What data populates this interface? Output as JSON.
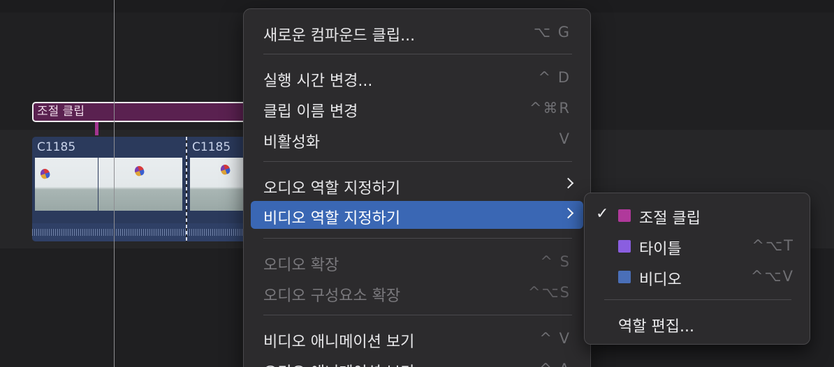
{
  "timeline": {
    "compound_clip_label": "조절 클립",
    "clips": [
      {
        "name": "C1185"
      },
      {
        "name": "C1185"
      }
    ]
  },
  "context_menu": {
    "items": [
      {
        "label": "새로운 컴파운드 클립...",
        "shortcut": "⌥ G",
        "enabled": true
      },
      {
        "label": "실행 시간 변경...",
        "shortcut": "^ D",
        "enabled": true
      },
      {
        "label": "클립 이름 변경",
        "shortcut": "^⌘R",
        "enabled": true
      },
      {
        "label": "비활성화",
        "shortcut": "V",
        "enabled": true
      },
      {
        "label": "오디오 역할 지정하기",
        "shortcut": "",
        "enabled": true,
        "submenu": true
      },
      {
        "label": "비디오 역할 지정하기",
        "shortcut": "",
        "enabled": true,
        "submenu": true,
        "highlighted": true
      },
      {
        "label": "오디오 확장",
        "shortcut": "^ S",
        "enabled": false
      },
      {
        "label": "오디오 구성요소 확장",
        "shortcut": "^⌥S",
        "enabled": false
      },
      {
        "label": "비디오 애니메이션 보기",
        "shortcut": "^ V",
        "enabled": true
      },
      {
        "label": "오디오 애니메이션 보기",
        "shortcut": "^ A",
        "enabled": true
      }
    ]
  },
  "video_roles_submenu": {
    "items": [
      {
        "label": "조절 클립",
        "checked": true,
        "color": "#b0399b",
        "shortcut": ""
      },
      {
        "label": "타이틀",
        "checked": false,
        "color": "#8a5ee0",
        "shortcut": "^⌥T"
      },
      {
        "label": "비디오",
        "checked": false,
        "color": "#4a6fb8",
        "shortcut": "^⌥V"
      }
    ],
    "edit_roles_label": "역할 편집...",
    "check_mark": "✓"
  }
}
